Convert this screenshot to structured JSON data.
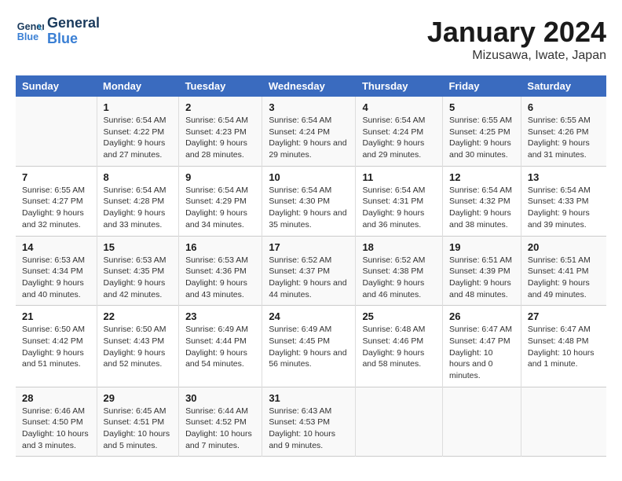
{
  "header": {
    "logo_line1": "General",
    "logo_line2": "Blue",
    "title": "January 2024",
    "subtitle": "Mizusawa, Iwate, Japan"
  },
  "columns": [
    "Sunday",
    "Monday",
    "Tuesday",
    "Wednesday",
    "Thursday",
    "Friday",
    "Saturday"
  ],
  "weeks": [
    [
      {
        "day": "",
        "sunrise": "",
        "sunset": "",
        "daylight": ""
      },
      {
        "day": "1",
        "sunrise": "Sunrise: 6:54 AM",
        "sunset": "Sunset: 4:22 PM",
        "daylight": "Daylight: 9 hours and 27 minutes."
      },
      {
        "day": "2",
        "sunrise": "Sunrise: 6:54 AM",
        "sunset": "Sunset: 4:23 PM",
        "daylight": "Daylight: 9 hours and 28 minutes."
      },
      {
        "day": "3",
        "sunrise": "Sunrise: 6:54 AM",
        "sunset": "Sunset: 4:24 PM",
        "daylight": "Daylight: 9 hours and 29 minutes."
      },
      {
        "day": "4",
        "sunrise": "Sunrise: 6:54 AM",
        "sunset": "Sunset: 4:24 PM",
        "daylight": "Daylight: 9 hours and 29 minutes."
      },
      {
        "day": "5",
        "sunrise": "Sunrise: 6:55 AM",
        "sunset": "Sunset: 4:25 PM",
        "daylight": "Daylight: 9 hours and 30 minutes."
      },
      {
        "day": "6",
        "sunrise": "Sunrise: 6:55 AM",
        "sunset": "Sunset: 4:26 PM",
        "daylight": "Daylight: 9 hours and 31 minutes."
      }
    ],
    [
      {
        "day": "7",
        "sunrise": "Sunrise: 6:55 AM",
        "sunset": "Sunset: 4:27 PM",
        "daylight": "Daylight: 9 hours and 32 minutes."
      },
      {
        "day": "8",
        "sunrise": "Sunrise: 6:54 AM",
        "sunset": "Sunset: 4:28 PM",
        "daylight": "Daylight: 9 hours and 33 minutes."
      },
      {
        "day": "9",
        "sunrise": "Sunrise: 6:54 AM",
        "sunset": "Sunset: 4:29 PM",
        "daylight": "Daylight: 9 hours and 34 minutes."
      },
      {
        "day": "10",
        "sunrise": "Sunrise: 6:54 AM",
        "sunset": "Sunset: 4:30 PM",
        "daylight": "Daylight: 9 hours and 35 minutes."
      },
      {
        "day": "11",
        "sunrise": "Sunrise: 6:54 AM",
        "sunset": "Sunset: 4:31 PM",
        "daylight": "Daylight: 9 hours and 36 minutes."
      },
      {
        "day": "12",
        "sunrise": "Sunrise: 6:54 AM",
        "sunset": "Sunset: 4:32 PM",
        "daylight": "Daylight: 9 hours and 38 minutes."
      },
      {
        "day": "13",
        "sunrise": "Sunrise: 6:54 AM",
        "sunset": "Sunset: 4:33 PM",
        "daylight": "Daylight: 9 hours and 39 minutes."
      }
    ],
    [
      {
        "day": "14",
        "sunrise": "Sunrise: 6:53 AM",
        "sunset": "Sunset: 4:34 PM",
        "daylight": "Daylight: 9 hours and 40 minutes."
      },
      {
        "day": "15",
        "sunrise": "Sunrise: 6:53 AM",
        "sunset": "Sunset: 4:35 PM",
        "daylight": "Daylight: 9 hours and 42 minutes."
      },
      {
        "day": "16",
        "sunrise": "Sunrise: 6:53 AM",
        "sunset": "Sunset: 4:36 PM",
        "daylight": "Daylight: 9 hours and 43 minutes."
      },
      {
        "day": "17",
        "sunrise": "Sunrise: 6:52 AM",
        "sunset": "Sunset: 4:37 PM",
        "daylight": "Daylight: 9 hours and 44 minutes."
      },
      {
        "day": "18",
        "sunrise": "Sunrise: 6:52 AM",
        "sunset": "Sunset: 4:38 PM",
        "daylight": "Daylight: 9 hours and 46 minutes."
      },
      {
        "day": "19",
        "sunrise": "Sunrise: 6:51 AM",
        "sunset": "Sunset: 4:39 PM",
        "daylight": "Daylight: 9 hours and 48 minutes."
      },
      {
        "day": "20",
        "sunrise": "Sunrise: 6:51 AM",
        "sunset": "Sunset: 4:41 PM",
        "daylight": "Daylight: 9 hours and 49 minutes."
      }
    ],
    [
      {
        "day": "21",
        "sunrise": "Sunrise: 6:50 AM",
        "sunset": "Sunset: 4:42 PM",
        "daylight": "Daylight: 9 hours and 51 minutes."
      },
      {
        "day": "22",
        "sunrise": "Sunrise: 6:50 AM",
        "sunset": "Sunset: 4:43 PM",
        "daylight": "Daylight: 9 hours and 52 minutes."
      },
      {
        "day": "23",
        "sunrise": "Sunrise: 6:49 AM",
        "sunset": "Sunset: 4:44 PM",
        "daylight": "Daylight: 9 hours and 54 minutes."
      },
      {
        "day": "24",
        "sunrise": "Sunrise: 6:49 AM",
        "sunset": "Sunset: 4:45 PM",
        "daylight": "Daylight: 9 hours and 56 minutes."
      },
      {
        "day": "25",
        "sunrise": "Sunrise: 6:48 AM",
        "sunset": "Sunset: 4:46 PM",
        "daylight": "Daylight: 9 hours and 58 minutes."
      },
      {
        "day": "26",
        "sunrise": "Sunrise: 6:47 AM",
        "sunset": "Sunset: 4:47 PM",
        "daylight": "Daylight: 10 hours and 0 minutes."
      },
      {
        "day": "27",
        "sunrise": "Sunrise: 6:47 AM",
        "sunset": "Sunset: 4:48 PM",
        "daylight": "Daylight: 10 hours and 1 minute."
      }
    ],
    [
      {
        "day": "28",
        "sunrise": "Sunrise: 6:46 AM",
        "sunset": "Sunset: 4:50 PM",
        "daylight": "Daylight: 10 hours and 3 minutes."
      },
      {
        "day": "29",
        "sunrise": "Sunrise: 6:45 AM",
        "sunset": "Sunset: 4:51 PM",
        "daylight": "Daylight: 10 hours and 5 minutes."
      },
      {
        "day": "30",
        "sunrise": "Sunrise: 6:44 AM",
        "sunset": "Sunset: 4:52 PM",
        "daylight": "Daylight: 10 hours and 7 minutes."
      },
      {
        "day": "31",
        "sunrise": "Sunrise: 6:43 AM",
        "sunset": "Sunset: 4:53 PM",
        "daylight": "Daylight: 10 hours and 9 minutes."
      },
      {
        "day": "",
        "sunrise": "",
        "sunset": "",
        "daylight": ""
      },
      {
        "day": "",
        "sunrise": "",
        "sunset": "",
        "daylight": ""
      },
      {
        "day": "",
        "sunrise": "",
        "sunset": "",
        "daylight": ""
      }
    ]
  ]
}
